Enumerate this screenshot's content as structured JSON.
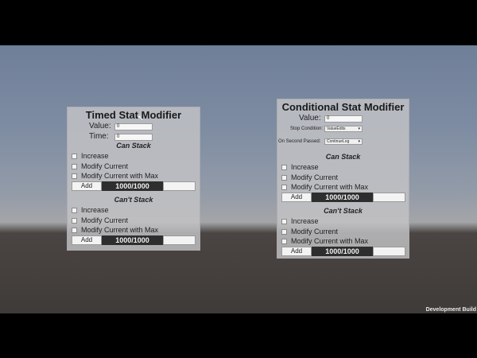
{
  "timed": {
    "title": "Timed Stat Modifier",
    "value_label": "Value:",
    "value": "0",
    "time_label": "Time:",
    "time": "0",
    "can_stack": {
      "header": "Can Stack",
      "options": [
        "Increase",
        "Modify Current",
        "Modify Current with Max"
      ],
      "add_label": "Add",
      "bar_text": "1000/1000",
      "bar_value": 1.0
    },
    "cant_stack": {
      "header": "Can't Stack",
      "options": [
        "Increase",
        "Modify Current",
        "Modify Current with Max"
      ],
      "add_label": "Add",
      "bar_text": "1000/1000",
      "bar_value": 1.0
    }
  },
  "conditional": {
    "title": "Conditional Stat Modifier",
    "value_label": "Value:",
    "value": "0",
    "stop_condition_label": "Stop Condition:",
    "stop_condition_value": "ValueEdits",
    "second_passed_label": "On Second Passed:",
    "second_passed_value": "ContinueLog",
    "can_stack": {
      "header": "Can Stack",
      "options": [
        "Increase",
        "Modify Current",
        "Modify Current with Max"
      ],
      "add_label": "Add",
      "bar_text": "1000/1000",
      "bar_value": 1.0
    },
    "cant_stack": {
      "header": "Can't Stack",
      "options": [
        "Increase",
        "Modify Current",
        "Modify Current with Max"
      ],
      "add_label": "Add",
      "bar_text": "1000/1000",
      "bar_value": 1.0
    }
  },
  "footer": {
    "build_label": "Development Build"
  },
  "colors": {
    "panel": "#c3c3c6",
    "bar": "#2e2e2e",
    "sky": "#7d8ca2",
    "ground": "#3f3b39"
  }
}
